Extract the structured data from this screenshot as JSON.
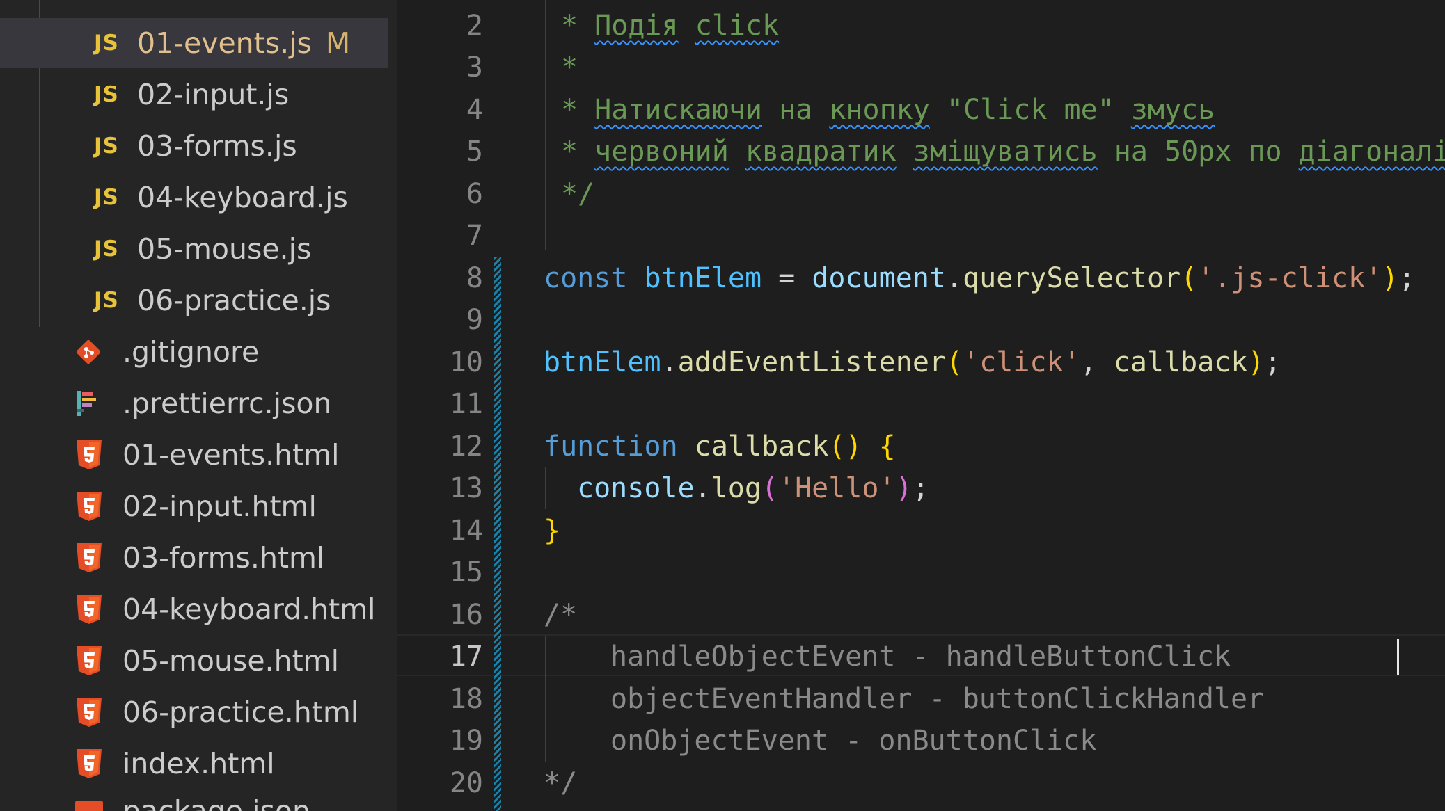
{
  "explorer": {
    "files": [
      {
        "icon": "js-icon",
        "label": "JS",
        "name": "01-events.js",
        "badge": "M",
        "selected": true
      },
      {
        "icon": "js-icon",
        "label": "JS",
        "name": "02-input.js"
      },
      {
        "icon": "js-icon",
        "label": "JS",
        "name": "03-forms.js"
      },
      {
        "icon": "js-icon",
        "label": "JS",
        "name": "04-keyboard.js"
      },
      {
        "icon": "js-icon",
        "label": "JS",
        "name": "05-mouse.js"
      },
      {
        "icon": "js-icon",
        "label": "JS",
        "name": "06-practice.js"
      },
      {
        "icon": "git-icon",
        "name": ".gitignore"
      },
      {
        "icon": "prettier-icon",
        "name": ".prettierrc.json"
      },
      {
        "icon": "html5-icon",
        "name": "01-events.html"
      },
      {
        "icon": "html5-icon",
        "name": "02-input.html"
      },
      {
        "icon": "html5-icon",
        "name": "03-forms.html"
      },
      {
        "icon": "html5-icon",
        "name": "04-keyboard.html"
      },
      {
        "icon": "html5-icon",
        "name": "05-mouse.html"
      },
      {
        "icon": "html5-icon",
        "name": "06-practice.html"
      },
      {
        "icon": "html5-icon",
        "name": "index.html"
      },
      {
        "icon": "json-icon",
        "name": "package.json"
      }
    ]
  },
  "editor": {
    "active_line": 17,
    "line_numbers": [
      "2",
      "3",
      "4",
      "5",
      "6",
      "7",
      "8",
      "9",
      "10",
      "11",
      "12",
      "13",
      "14",
      "15",
      "16",
      "17",
      "18",
      "19",
      "20"
    ],
    "code": {
      "l2_star": "* ",
      "l2_w1": "Подія",
      "l2_sp": " ",
      "l2_w2": "click",
      "l3": "*",
      "l4_star": "* ",
      "l4_w1": "Натискаючи",
      "l4_mid": " на ",
      "l4_w2": "кнопку",
      "l4_mid2": " \"Click me\" ",
      "l4_w3": "змусь",
      "l5_star": "* ",
      "l5_w1": "червоний",
      "l5_sp1": " ",
      "l5_w2": "квадратик",
      "l5_sp2": " ",
      "l5_w3": "зміщуватись",
      "l5_mid": " на 50px по ",
      "l5_w4": "діагоналі",
      "l6": "*/",
      "l8_kw": "const",
      "l8_var": "btnElem",
      "l8_eq": " = ",
      "l8_obj": "document",
      "l8_dot": ".",
      "l8_fn": "querySelector",
      "l8_p1": "(",
      "l8_str": "'.js-click'",
      "l8_p2": ")",
      "l8_semi": ";",
      "l10_var": "btnElem",
      "l10_dot": ".",
      "l10_fn": "addEventListener",
      "l10_p1": "(",
      "l10_str": "'click'",
      "l10_comma": ", ",
      "l10_arg": "callback",
      "l10_p2": ")",
      "l10_semi": ";",
      "l12_kw": "function",
      "l12_fn": "callback",
      "l12_paren": "()",
      "l12_brace": "{",
      "l13_obj": "console",
      "l13_dot": ".",
      "l13_fn": "log",
      "l13_p1": "(",
      "l13_str": "'Hello'",
      "l13_p2": ")",
      "l13_semi": ";",
      "l14_brace": "}",
      "l16": "/*",
      "l17": "handleObjectEvent - handleButtonClick",
      "l18": "objectEventHandler - buttonClickHandler",
      "l19": "onObjectEvent - onButtonClick",
      "l20": "*/"
    }
  },
  "colors": {
    "sidebar_bg": "#252526",
    "editor_bg": "#1e1e1e",
    "js_icon": "#e8c33a",
    "html_icon": "#e44d26",
    "keyword": "#569cd6",
    "string": "#ce9178",
    "function": "#dcdcaa"
  }
}
